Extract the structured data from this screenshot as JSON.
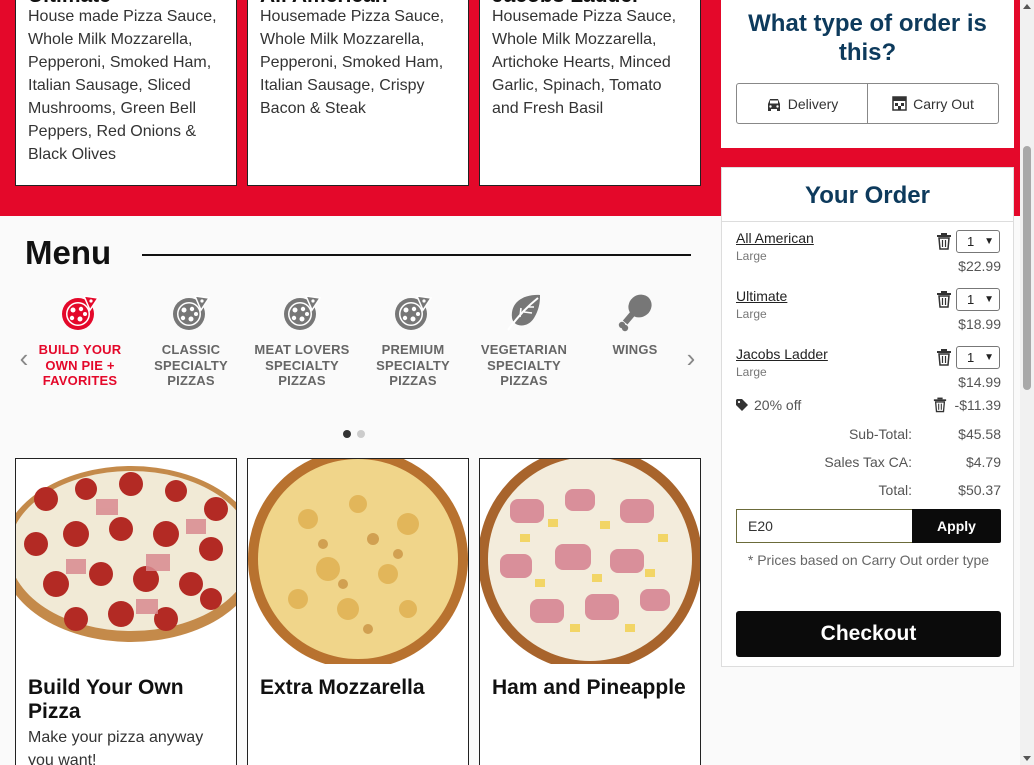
{
  "featured": [
    {
      "title": "Ultimate",
      "desc": "House made Pizza Sauce, Whole Milk Mozzarella, Pepperoni, Smoked Ham, Italian Sausage, Sliced Mushrooms, Green Bell Peppers, Red Onions & Black Olives"
    },
    {
      "title": "All American",
      "desc": "Housemade Pizza Sauce, Whole Milk Mozzarella, Pepperoni, Smoked Ham, Italian Sausage, Crispy Bacon & Steak"
    },
    {
      "title": "Jacobs Ladder",
      "desc": "Housemade Pizza Sauce, Whole Milk Mozzarella, Artichoke Hearts, Minced Garlic, Spinach, Tomato and Fresh Basil"
    }
  ],
  "menu": {
    "heading": "Menu",
    "prev_arrow": "‹",
    "next_arrow": "›",
    "categories": [
      {
        "label": "BUILD YOUR OWN PIE + FAVORITES",
        "icon": "pizza-icon",
        "active": true
      },
      {
        "label": "CLASSIC SPECIALTY PIZZAS",
        "icon": "pizza-icon"
      },
      {
        "label": "MEAT LOVERS SPECIALTY PIZZAS",
        "icon": "pizza-icon"
      },
      {
        "label": "PREMIUM SPECIALTY PIZZAS",
        "icon": "pizza-icon"
      },
      {
        "label": "VEGETARIAN SPECIALTY PIZZAS",
        "icon": "leaf-icon"
      },
      {
        "label": "WINGS",
        "icon": "drumstick-icon"
      }
    ]
  },
  "products": [
    {
      "title": "Build Your Own Pizza",
      "desc": "Make your pizza anyway you want!",
      "image": "pepperoni-pizza"
    },
    {
      "title": "Extra Mozzarella",
      "desc": "",
      "image": "cheese-pizza"
    },
    {
      "title": "Ham and Pineapple",
      "desc": "",
      "image": "ham-pineapple-pizza"
    }
  ],
  "order_type": {
    "question": "What type of order is this?",
    "delivery_label": "Delivery",
    "carryout_label": "Carry Out"
  },
  "order": {
    "title": "Your Order",
    "items": [
      {
        "name": "All American",
        "size": "Large",
        "qty": "1",
        "price": "$22.99"
      },
      {
        "name": "Ultimate",
        "size": "Large",
        "qty": "1",
        "price": "$18.99"
      },
      {
        "name": "Jacobs Ladder",
        "size": "Large",
        "qty": "1",
        "price": "$14.99"
      }
    ],
    "discount": {
      "label": "20% off",
      "amount": "-$11.39"
    },
    "subtotal_label": "Sub-Total:",
    "subtotal": "$45.58",
    "tax_label": "Sales Tax CA:",
    "tax": "$4.79",
    "total_label": "Total:",
    "total": "$50.37",
    "promo_value": "E20",
    "apply_label": "Apply",
    "note": "* Prices based on Carry Out order type",
    "checkout_label": "Checkout"
  },
  "colors": {
    "brand_red": "#e4082a",
    "heading_navy": "#0d3a5c",
    "button_black": "#0b0b0b"
  }
}
